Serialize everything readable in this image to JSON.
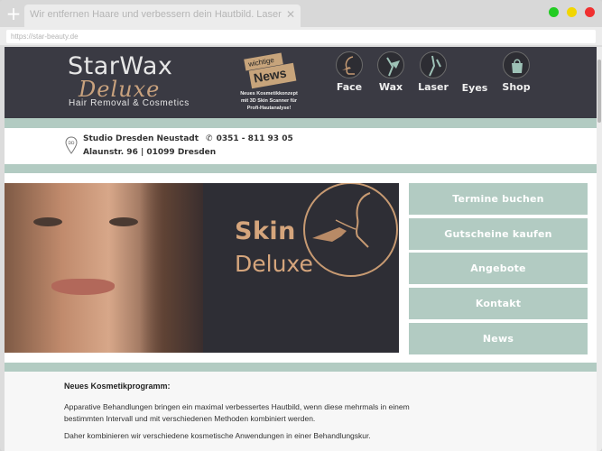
{
  "browser": {
    "tab_title": "Wir entfernen Haare und verbessern dein Hautbild. Laser Haare",
    "new_tab_glyph": "+",
    "close_glyph": "✕",
    "url": "https://star-beauty.de"
  },
  "header": {
    "logo_main": "StarWax",
    "logo_script": "Deluxe",
    "logo_sub": "Hair Removal & Cosmetics",
    "news_label": "wichtige",
    "news_main": "News",
    "news_text": "Neues Kosmetikkonzept mit 3D Skin Scanner für Profi-Hautanalyse!",
    "nav": [
      {
        "label": "Face",
        "icon": "face-icon"
      },
      {
        "label": "Wax",
        "icon": "wax-icon"
      },
      {
        "label": "Laser",
        "icon": "laser-icon"
      },
      {
        "label": "Eyes",
        "icon": ""
      },
      {
        "label": "Shop",
        "icon": "shop-icon"
      }
    ]
  },
  "info": {
    "pin_label": "DD",
    "studio": "Studio Dresden Neustadt",
    "phone": "0351 - 811 93 05",
    "address": "Alaunstr. 96 | 01099 Dresden"
  },
  "hero": {
    "title1": "Skin",
    "title2": "Deluxe"
  },
  "sidebar": {
    "buttons": [
      "Termine buchen",
      "Gutscheine kaufen",
      "Angebote",
      "Kontakt",
      "News"
    ]
  },
  "content": {
    "title": "Neues Kosmetikprogramm:",
    "p1": "Apparative Behandlungen bringen ein maximal verbessertes Hautbild, wenn diese mehrmals in einem bestimmten Intervall und mit verschiedenen Methoden kombiniert werden.",
    "p2": "Daher kombinieren wir verschiedene kosmetische Anwendungen in einer Behandlungskur."
  },
  "colors": {
    "accent": "#b2cbc2",
    "header_bg": "#3a3a43",
    "gold": "#c7a47b"
  }
}
